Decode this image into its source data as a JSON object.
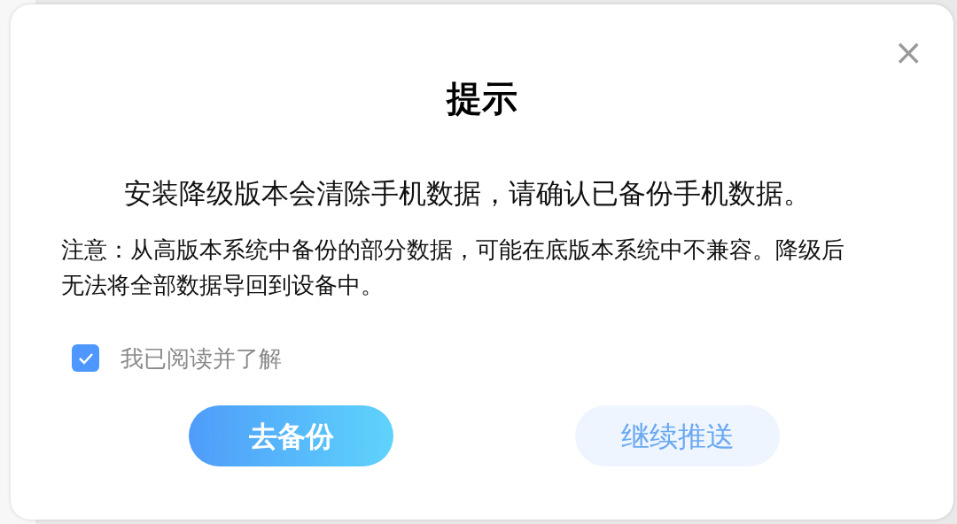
{
  "dialog": {
    "title": "提示",
    "close": "×",
    "message": "安装降级版本会清除手机数据，请确认已备份手机数据。",
    "note": "注意：从高版本系统中备份的部分数据，可能在底版本系统中不兼容。降级后无法将全部数据导回到设备中。",
    "agreement": {
      "label": "我已阅读并了解",
      "checked": true
    },
    "buttons": [
      {
        "label": "去备份",
        "kind": "primary"
      },
      {
        "label": "继续推送",
        "kind": "secondary"
      }
    ]
  }
}
